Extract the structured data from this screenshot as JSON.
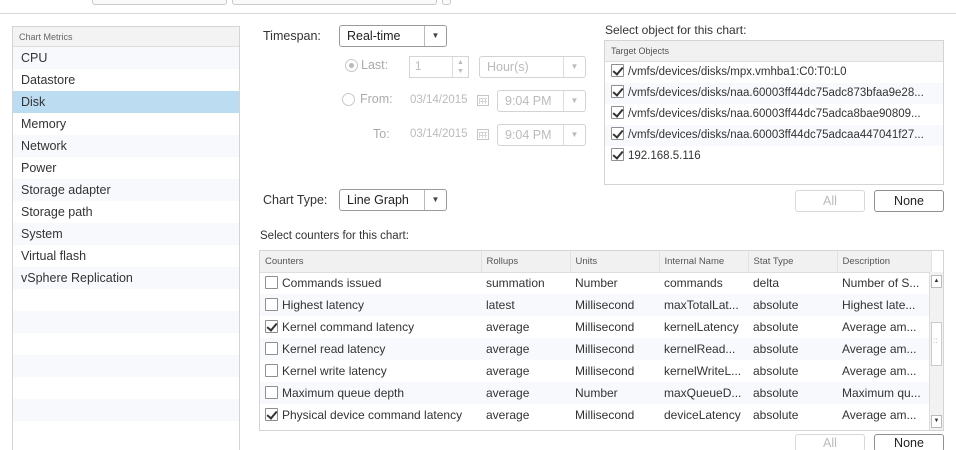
{
  "metrics": {
    "header": "Chart Metrics",
    "items": [
      "CPU",
      "Datastore",
      "Disk",
      "Memory",
      "Network",
      "Power",
      "Storage adapter",
      "Storage path",
      "System",
      "Virtual flash",
      "vSphere Replication"
    ],
    "selected": "Disk"
  },
  "timespan": {
    "label": "Timespan:",
    "value": "Real-time",
    "last_label": "Last:",
    "last_value": "1",
    "unit": "Hour(s)",
    "from_label": "From:",
    "from_date": "03/14/2015",
    "from_time": "9:04 PM",
    "to_label": "To:",
    "to_date": "03/14/2015",
    "to_time": "9:04 PM"
  },
  "chart_type": {
    "label": "Chart Type:",
    "value": "Line Graph"
  },
  "targets": {
    "title": "Select object for this chart:",
    "header": "Target Objects",
    "items": [
      {
        "label": "/vmfs/devices/disks/mpx.vmhba1:C0:T0:L0",
        "checked": true
      },
      {
        "label": "/vmfs/devices/disks/naa.60003ff44dc75adc873bfaa9e28...",
        "checked": true
      },
      {
        "label": "/vmfs/devices/disks/naa.60003ff44dc75adca8bae90809...",
        "checked": true
      },
      {
        "label": "/vmfs/devices/disks/naa.60003ff44dc75adcaa447041f27...",
        "checked": true
      },
      {
        "label": "192.168.5.116",
        "checked": true
      }
    ],
    "all_label": "All",
    "none_label": "None"
  },
  "counters": {
    "title": "Select counters for this chart:",
    "columns": [
      "Counters",
      "Rollups",
      "Units",
      "Internal Name",
      "Stat Type",
      "Description"
    ],
    "rows": [
      {
        "checked": false,
        "name": "Commands issued",
        "rollup": "summation",
        "units": "Number",
        "internal": "commands",
        "stat": "delta",
        "desc": "Number of S..."
      },
      {
        "checked": false,
        "name": "Highest latency",
        "rollup": "latest",
        "units": "Millisecond",
        "internal": "maxTotalLat...",
        "stat": "absolute",
        "desc": "Highest late..."
      },
      {
        "checked": true,
        "name": "Kernel command latency",
        "rollup": "average",
        "units": "Millisecond",
        "internal": "kernelLatency",
        "stat": "absolute",
        "desc": "Average am..."
      },
      {
        "checked": false,
        "name": "Kernel read latency",
        "rollup": "average",
        "units": "Millisecond",
        "internal": "kernelRead...",
        "stat": "absolute",
        "desc": "Average am..."
      },
      {
        "checked": false,
        "name": "Kernel write latency",
        "rollup": "average",
        "units": "Millisecond",
        "internal": "kernelWriteL...",
        "stat": "absolute",
        "desc": "Average am..."
      },
      {
        "checked": false,
        "name": "Maximum queue depth",
        "rollup": "average",
        "units": "Number",
        "internal": "maxQueueD...",
        "stat": "absolute",
        "desc": "Maximum qu..."
      },
      {
        "checked": true,
        "name": "Physical device command latency",
        "rollup": "average",
        "units": "Millisecond",
        "internal": "deviceLatency",
        "stat": "absolute",
        "desc": "Average am..."
      }
    ],
    "all_label": "All",
    "none_label": "None"
  },
  "colors": {
    "selected_row": "#bcdcf2",
    "alt_row": "#f7f9fc",
    "border": "#d4d4d4"
  }
}
